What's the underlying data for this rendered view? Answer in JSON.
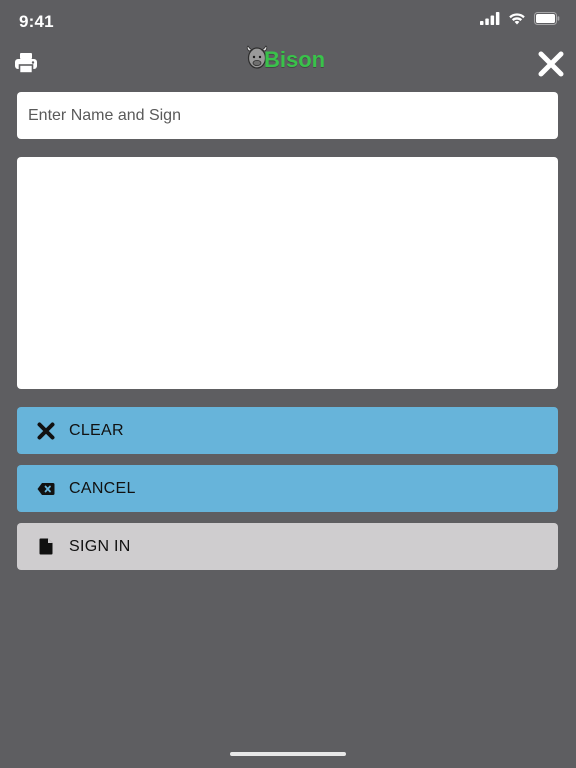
{
  "status_bar": {
    "time": "9:41"
  },
  "header": {
    "logo_text": "Bison"
  },
  "form": {
    "name_placeholder": "Enter Name and Sign",
    "name_value": ""
  },
  "buttons": {
    "clear": "CLEAR",
    "cancel": "CANCEL",
    "sign_in": "SIGN IN"
  },
  "icons": {
    "print": "print-icon",
    "close": "close-icon",
    "clear": "x-icon",
    "cancel": "backspace-icon",
    "sign_in": "file-icon"
  },
  "colors": {
    "background": "#5e5e61",
    "primary_button": "#67b4da",
    "secondary_button": "#cfcdcf",
    "logo": "#39c24a"
  }
}
